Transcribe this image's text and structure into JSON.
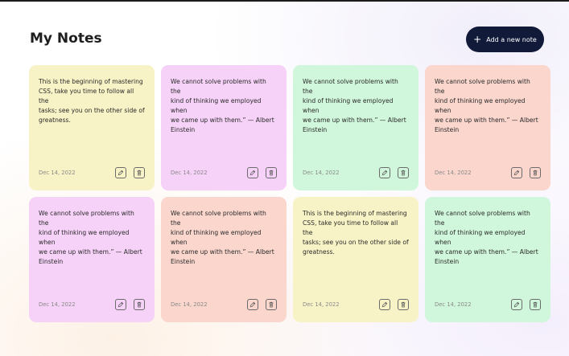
{
  "header": {
    "title": "My Notes",
    "add_button_label": "Add a new note"
  },
  "icons": {
    "add": "plus-icon",
    "edit": "pencil-icon",
    "delete": "trash-icon"
  },
  "colors": {
    "yellow": "#f8f3c6",
    "pink": "#f7d2f8",
    "green": "#d0f7db",
    "salmon": "#fad6cd",
    "button": "#121a3a"
  },
  "notes": [
    {
      "text": "This is the beginning of mastering\nCSS, take you time to follow all the\ntasks; see you on the other side of\ngreatness.",
      "date": "Dec 14, 2022",
      "color": "#f8f3c6"
    },
    {
      "text": "We cannot solve problems with the\nkind of thinking we employed when\nwe came up with them.” — Albert\nEinstein",
      "date": "Dec 14, 2022",
      "color": "#f7d2f8"
    },
    {
      "text": "We cannot solve problems with the\nkind of thinking we employed when\nwe came up with them.” — Albert\nEinstein",
      "date": "Dec 14, 2022",
      "color": "#d0f7db"
    },
    {
      "text": "We cannot solve problems with the\nkind of thinking we employed when\nwe came up with them.” — Albert\nEinstein",
      "date": "Dec 14, 2022",
      "color": "#fad6cd"
    },
    {
      "text": "We cannot solve problems with the\nkind of thinking we employed when\nwe came up with them.” — Albert\nEinstein",
      "date": "Dec 14, 2022",
      "color": "#f7d2f8"
    },
    {
      "text": "We cannot solve problems with the\nkind of thinking we employed when\nwe came up with them.” — Albert\nEinstein",
      "date": "Dec 14, 2022",
      "color": "#fad6cd"
    },
    {
      "text": "This is the beginning of mastering\nCSS, take you time to follow all the\ntasks; see you on the other side of\ngreatness.",
      "date": "Dec 14, 2022",
      "color": "#f8f3c6"
    },
    {
      "text": "We cannot solve problems with the\nkind of thinking we employed when\nwe came up with them.” — Albert\nEinstein",
      "date": "Dec 14, 2022",
      "color": "#d0f7db"
    }
  ]
}
